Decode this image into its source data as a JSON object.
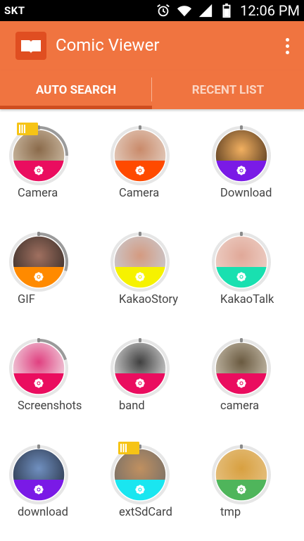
{
  "status_bar": {
    "carrier": "SKT",
    "time": "12:06 PM"
  },
  "app_bar": {
    "title": "Comic Viewer"
  },
  "tabs": [
    {
      "label": "AUTO SEARCH",
      "selected": true
    },
    {
      "label": "RECENT LIST",
      "selected": false
    }
  ],
  "colors": {
    "primary": "#f07440",
    "primary_dark": "#cf4d1f",
    "status_bar": "#000000"
  },
  "folders": [
    {
      "label": "Camera",
      "band_color": "#ea0d5f",
      "thumb": "curly-hair-photo",
      "progress": 0.25,
      "sd_card": true
    },
    {
      "label": "Camera",
      "band_color": "#ff4a00",
      "thumb": "baby-photo",
      "progress": 0.0,
      "sd_card": false
    },
    {
      "label": "Download",
      "band_color": "#7a1ae6",
      "thumb": "fire-photo",
      "progress": 0.0,
      "sd_card": false
    },
    {
      "label": "GIF",
      "band_color": "#ff8a00",
      "thumb": "woman-photo",
      "progress": 0.3,
      "sd_card": false
    },
    {
      "label": "KakaoStory",
      "band_color": "#f6f200",
      "thumb": "baby-photo-2",
      "progress": 0.0,
      "sd_card": false
    },
    {
      "label": "KakaoTalk",
      "band_color": "#19e0b0",
      "thumb": "newborn-photo",
      "progress": 0.0,
      "sd_card": false
    },
    {
      "label": "Screenshots",
      "band_color": "#ea0d5f",
      "thumb": "cartoon-screenshot",
      "progress": 0.2,
      "sd_card": false
    },
    {
      "label": "band",
      "band_color": "#ea0d5f",
      "thumb": "sketch-face",
      "progress": 0.0,
      "sd_card": false
    },
    {
      "label": "camera",
      "band_color": "#ea0d5f",
      "thumb": "food-photo",
      "progress": 0.0,
      "sd_card": false
    },
    {
      "label": "download",
      "band_color": "#7a1ae6",
      "thumb": "screen-photo",
      "progress": 0.0,
      "sd_card": false
    },
    {
      "label": "extSdCard",
      "band_color": "#1ae6f0",
      "thumb": "city-photo",
      "progress": 0.0,
      "sd_card": true
    },
    {
      "label": "tmp",
      "band_color": "#4fb55b",
      "thumb": "forest-photo",
      "progress": 0.0,
      "sd_card": false
    }
  ]
}
